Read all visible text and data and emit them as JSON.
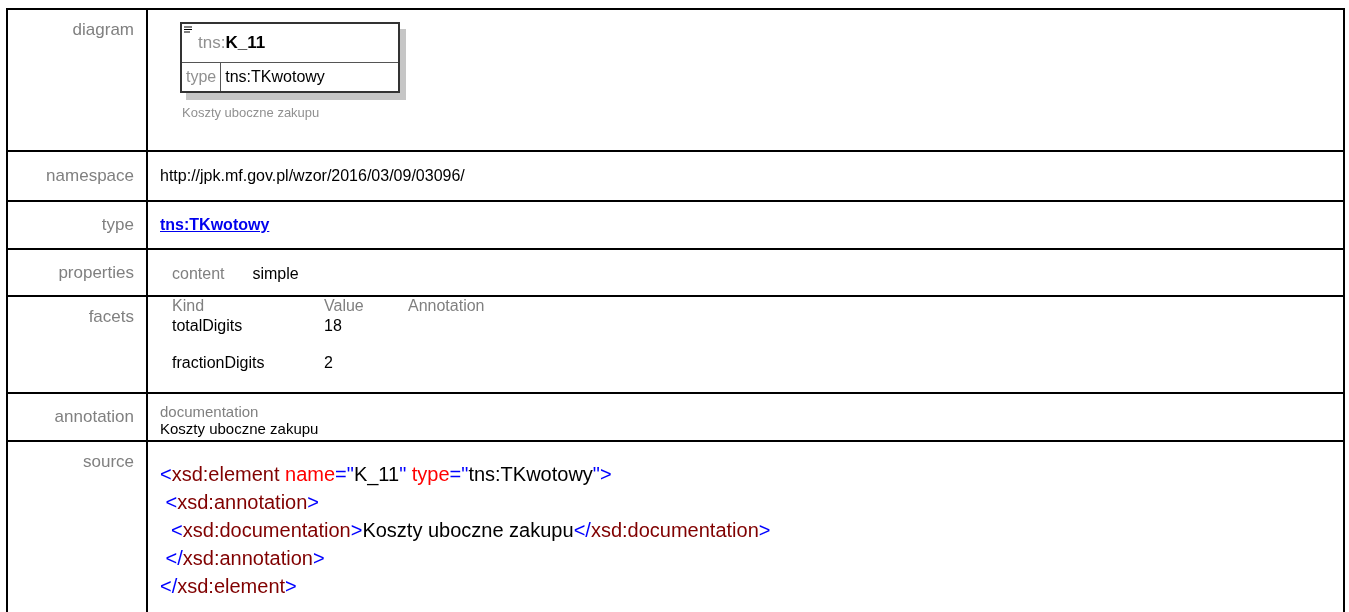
{
  "diagram": {
    "label": "diagram",
    "element_prefix": "tns:",
    "element_name": "K_11",
    "type_label": "type",
    "type_value": "tns:TKwotowy",
    "caption": "Koszty uboczne zakupu"
  },
  "namespace": {
    "label": "namespace",
    "value": "http://jpk.mf.gov.pl/wzor/2016/03/09/03096/"
  },
  "type": {
    "label": "type",
    "link": "tns:TKwotowy"
  },
  "properties": {
    "label": "properties",
    "items": [
      {
        "name": "content",
        "value": "simple"
      }
    ]
  },
  "facets": {
    "label": "facets",
    "columns": [
      "Kind",
      "Value",
      "Annotation"
    ],
    "rows": [
      {
        "kind": "totalDigits",
        "value": "18"
      },
      {
        "kind": "fractionDigits",
        "value": "2"
      }
    ]
  },
  "annotation": {
    "label": "annotation",
    "heading": "documentation",
    "text": "Koszty uboczne zakupu"
  },
  "source": {
    "label": "source",
    "lines": [
      {
        "tokens": [
          {
            "kind": "bracket",
            "text": "<"
          },
          {
            "kind": "tag",
            "text": "xsd:element "
          },
          {
            "kind": "attr",
            "text": "name"
          },
          {
            "kind": "bracket",
            "text": "=\""
          },
          {
            "kind": "value",
            "text": "K_11"
          },
          {
            "kind": "bracket",
            "text": "\" "
          },
          {
            "kind": "attr",
            "text": "type"
          },
          {
            "kind": "bracket",
            "text": "=\""
          },
          {
            "kind": "value",
            "text": "tns:TKwotowy"
          },
          {
            "kind": "bracket",
            "text": "\">"
          }
        ]
      },
      {
        "tokens": [
          {
            "kind": "bracket",
            "text": " <"
          },
          {
            "kind": "tag",
            "text": "xsd:annotation"
          },
          {
            "kind": "bracket",
            "text": ">"
          }
        ]
      },
      {
        "tokens": [
          {
            "kind": "bracket",
            "text": "  <"
          },
          {
            "kind": "tag",
            "text": "xsd:documentation"
          },
          {
            "kind": "bracket",
            "text": ">"
          },
          {
            "kind": "value",
            "text": "Koszty uboczne zakupu"
          },
          {
            "kind": "bracket",
            "text": "</"
          },
          {
            "kind": "tag",
            "text": "xsd:documentation"
          },
          {
            "kind": "bracket",
            "text": ">"
          }
        ]
      },
      {
        "tokens": [
          {
            "kind": "bracket",
            "text": " </"
          },
          {
            "kind": "tag",
            "text": "xsd:annotation"
          },
          {
            "kind": "bracket",
            "text": ">"
          }
        ]
      },
      {
        "tokens": [
          {
            "kind": "bracket",
            "text": "</"
          },
          {
            "kind": "tag",
            "text": "xsd:element"
          },
          {
            "kind": "bracket",
            "text": ">"
          }
        ]
      }
    ]
  }
}
